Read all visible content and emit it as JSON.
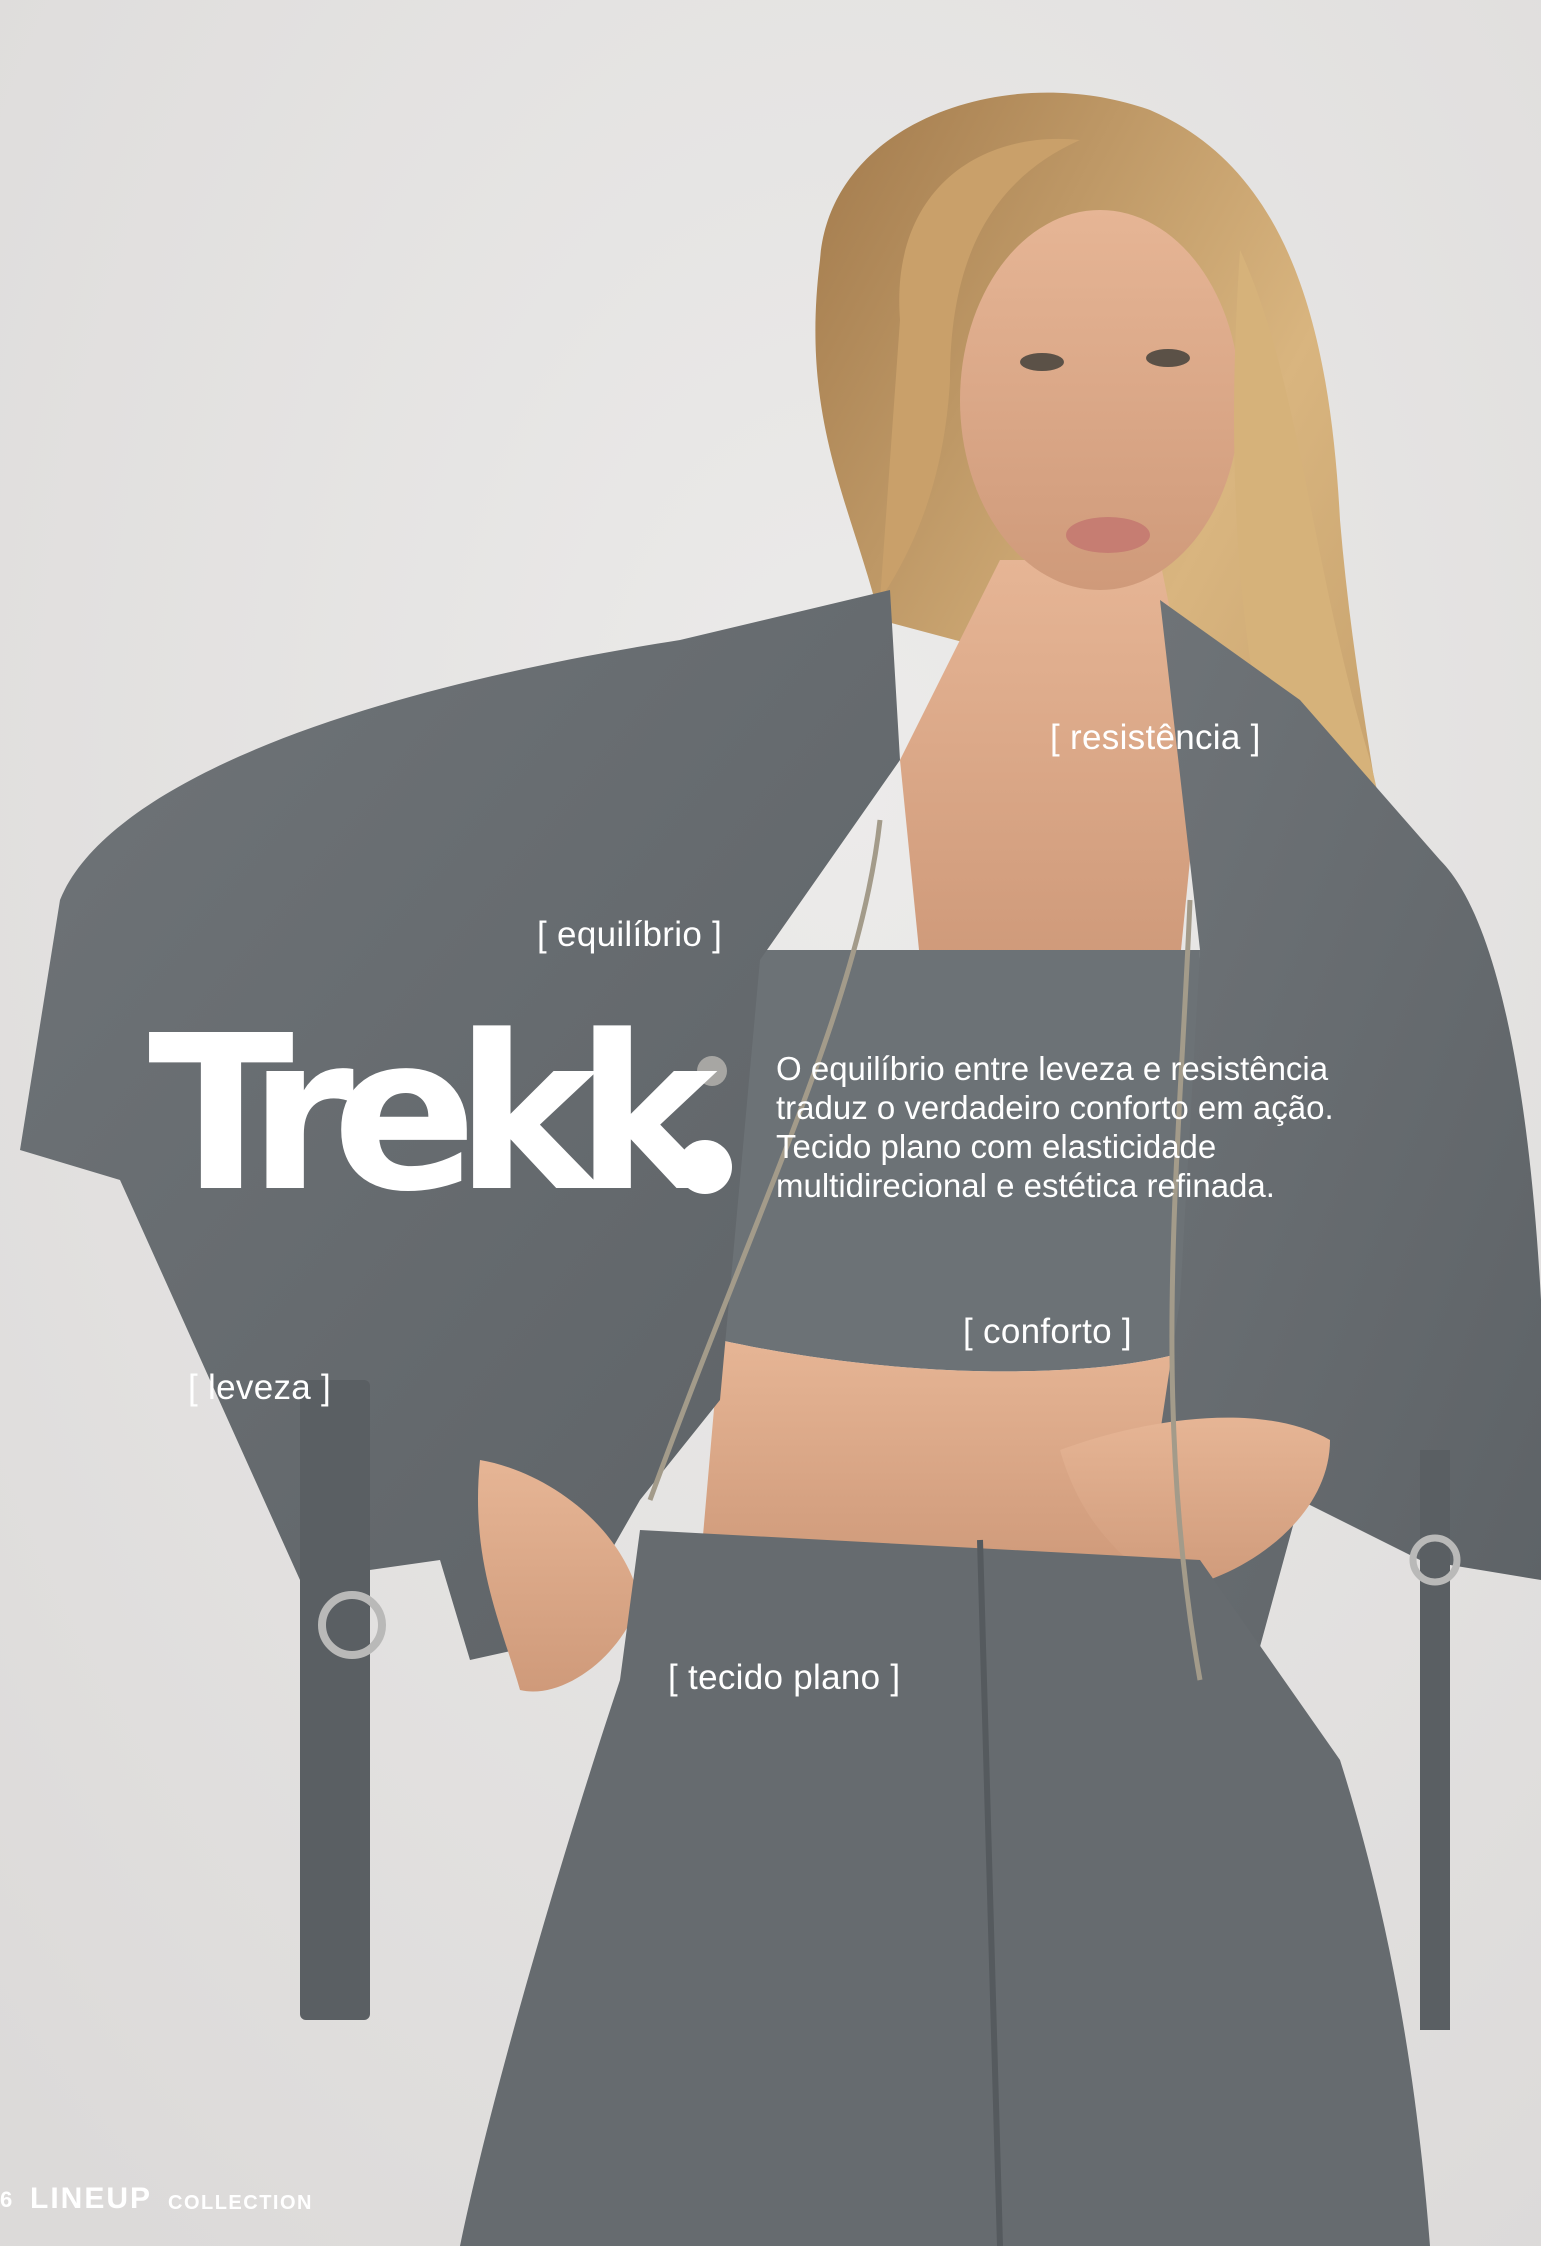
{
  "headline": "Trekk",
  "description": {
    "lines": [
      "O equilíbrio entre leveza e resistência",
      "traduz o verdadeiro conforto em ação.",
      "Tecido plano com elasticidade",
      "multidirecional e estética refinada."
    ]
  },
  "tags": {
    "resistencia": "[ resistência ]",
    "equilibrio": "[ equilíbrio ]",
    "conforto": "[ conforto ]",
    "leveza": "[ leveza ]",
    "tecido_plano": "[ tecido plano ]"
  },
  "footer": {
    "page_number": "6",
    "brand": "LINEUP",
    "section": "COLLECTION"
  },
  "colors": {
    "background": "#e4e2e1",
    "garment": "#686d71",
    "text": "#ffffff"
  }
}
